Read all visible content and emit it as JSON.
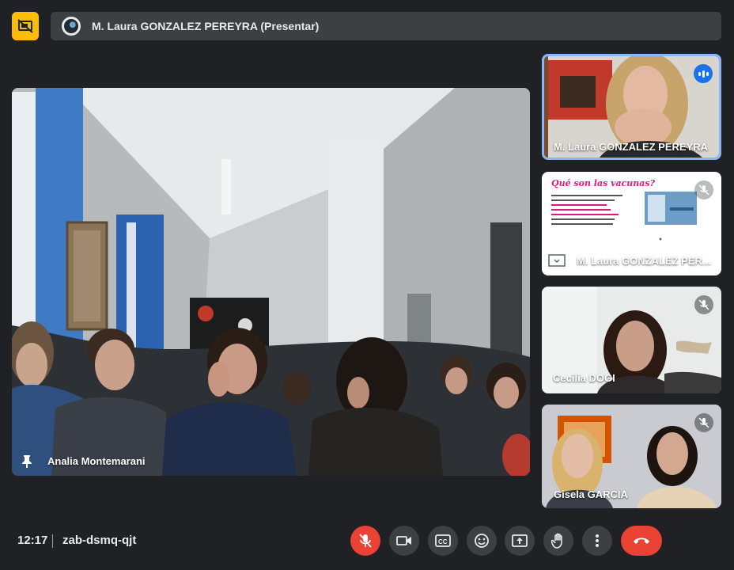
{
  "presentation": {
    "title": "M. Laura GONZALEZ PEREYRA (Presentar)",
    "badge_icon": "present-off-icon"
  },
  "main_tile": {
    "name": "Analia Montemarani",
    "pinned": true
  },
  "side_tiles": [
    {
      "name": "M. Laura GONZALEZ PEREYRA",
      "speaking": true
    },
    {
      "name": "M. Laura GONZALEZ PER...",
      "muted": true,
      "slide": {
        "title": "Qué son las vacunas?"
      }
    },
    {
      "name": "Cecilia DOGI",
      "muted": true
    },
    {
      "name": "Gisela GARCIA",
      "muted": true
    }
  ],
  "bottom_bar": {
    "time": "12:17",
    "meeting_code": "zab-dsmq-qjt",
    "controls": [
      "mic-off-icon",
      "camera-icon",
      "captions-icon",
      "emoji-icon",
      "present-screen-icon",
      "raise-hand-icon",
      "more-options-icon",
      "end-call-icon"
    ]
  },
  "colors": {
    "background": "#202124",
    "accent_blue": "#8ab4f8",
    "present_yellow": "#fbbc04",
    "danger_red": "#ea4335",
    "bar_grey": "#3c4043"
  }
}
